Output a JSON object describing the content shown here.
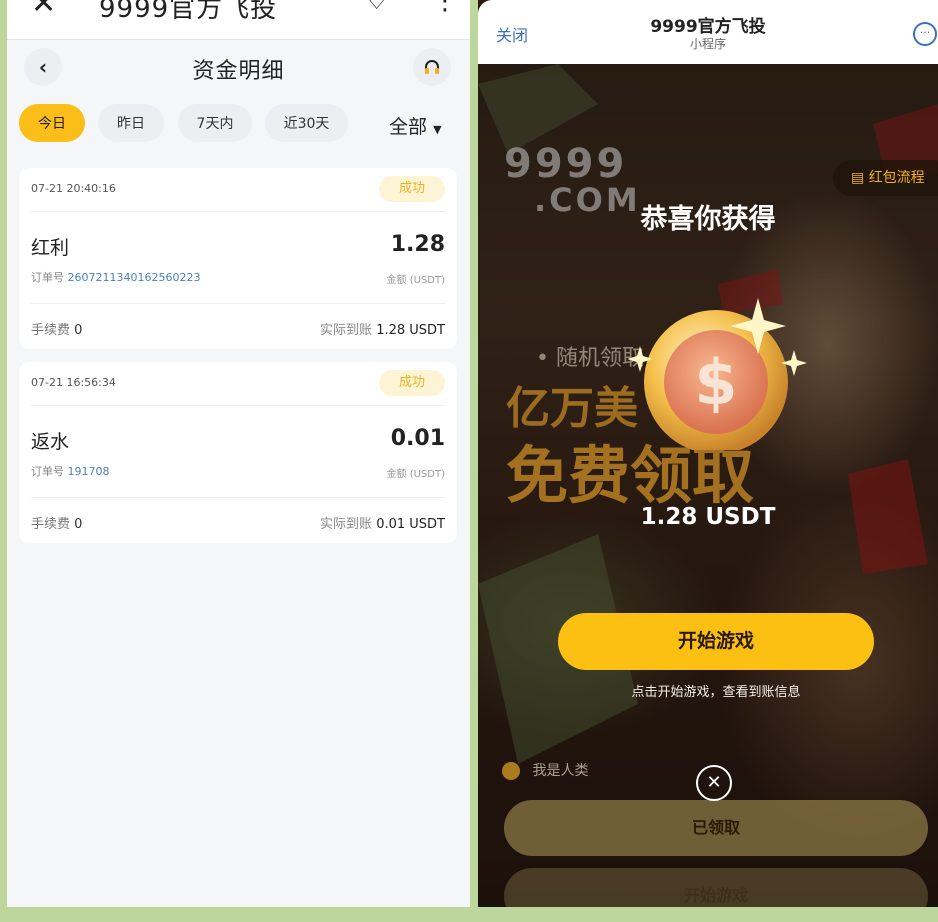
{
  "left": {
    "topbar": {
      "close_glyph": "✕",
      "title": "9999官方飞投",
      "heart_glyph": "♡",
      "more_glyph": "⋮"
    },
    "header": {
      "back_glyph": "‹",
      "title": "资金明细",
      "support_icon": "headphones-icon"
    },
    "filters": {
      "today": "今日",
      "yesterday": "昨日",
      "seven_days": "7天内",
      "thirty_days": "近30天",
      "all": "全部"
    },
    "records": [
      {
        "time": "07-21 20:40:16",
        "status": "成功",
        "type": "红利",
        "amount": "1.28",
        "order_label": "订单号",
        "order_no": "2607211340162560223",
        "amount_label": "金额 (USDT)",
        "fee_label": "手续费",
        "fee": "0",
        "actual_label": "实际到账",
        "actual": "1.28 USDT"
      },
      {
        "time": "07-21 16:56:34",
        "status": "成功",
        "type": "返水",
        "amount": "0.01",
        "order_label": "订单号",
        "order_no": "191708",
        "amount_label": "金额 (USDT)",
        "fee_label": "手续费",
        "fee": "0",
        "actual_label": "实际到账",
        "actual": "0.01 USDT"
      }
    ]
  },
  "right": {
    "miniprogram": {
      "close": "关闭",
      "name": "9999官方飞投",
      "subtitle": "小程序",
      "more_glyph": "···"
    },
    "logo": {
      "line1": "9999",
      "line2": ".COM"
    },
    "red_packet_flow": "红包流程",
    "congrats": "恭喜你获得",
    "promo_line1": "• 随机领取",
    "promo_line2": "亿万美",
    "promo_line3": "免费领取",
    "reward": "1.28 USDT",
    "start_button": "开始游戏",
    "hint": "点击开始游戏，查看到账信息",
    "human_check": "我是人类",
    "close_glyph": "✕",
    "claimed_button": "已领取",
    "start_button2": "开始游戏"
  },
  "colors": {
    "accent": "#fbbd17",
    "link": "#3a6fc4",
    "order_no": "#4a7fc1",
    "success_bg": "#fdf4d6",
    "success_text": "#f2b21d"
  }
}
